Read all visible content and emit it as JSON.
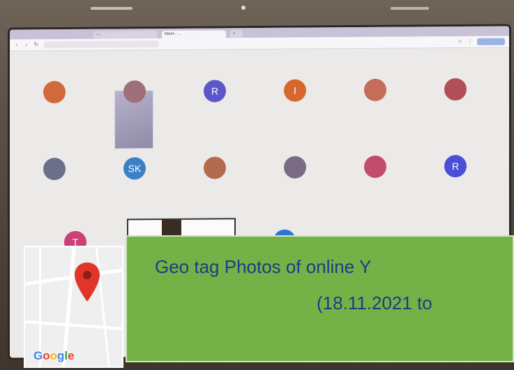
{
  "browser": {
    "tabs": [
      {
        "label": "—"
      },
      {
        "label": "Meet - ..."
      },
      {
        "label": "+"
      }
    ]
  },
  "meet": {
    "participants": [
      {
        "initial": "",
        "name": "",
        "color": "#d06a3d"
      },
      {
        "initial": "",
        "name": "",
        "color": "#9f6f7a"
      },
      {
        "initial": "R",
        "name": "",
        "color": "#5b56c9"
      },
      {
        "initial": "I",
        "name": "",
        "color": "#d6682f"
      },
      {
        "initial": "",
        "name": "",
        "color": "#c46d58"
      },
      {
        "initial": "",
        "name": "",
        "color": "#b04f56"
      },
      {
        "initial": "",
        "name": "",
        "color": "#6b6f8a"
      },
      {
        "initial": "SK",
        "name": "",
        "color": "#3c7fc7"
      },
      {
        "initial": "",
        "name": "",
        "color": "#b36a4f"
      },
      {
        "initial": "",
        "name": "",
        "color": "#7a6b84"
      },
      {
        "initial": "",
        "name": "",
        "color": "#c44c6b"
      },
      {
        "initial": "R",
        "name": "",
        "color": "#4b4fd6"
      },
      {
        "initial": "T",
        "name": "",
        "color": "#cd3f77"
      },
      {
        "initial": "S",
        "name": "",
        "color": "#2f72d6"
      }
    ]
  },
  "banner": {
    "line1": "Geo tag Photos of online Y",
    "line2": "(18.11.2021 to"
  },
  "map": {
    "logo_text": "Google",
    "pin_color": "#e0352b",
    "logo_colors": [
      "#4285f4",
      "#ea4335",
      "#fbbc05",
      "#4285f4",
      "#34a853",
      "#ea4335"
    ]
  },
  "colors": {
    "banner_bg": "#74b248",
    "banner_text": "#1f3b82"
  }
}
